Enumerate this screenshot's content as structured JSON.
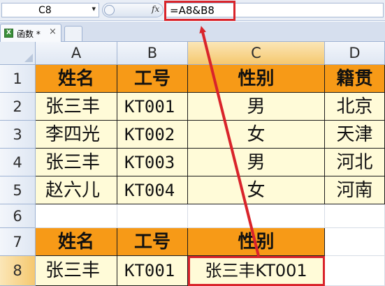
{
  "formula_bar": {
    "name_box": "C8",
    "name_box_arrow": "▾",
    "fx_label": "fx",
    "formula": "=A8&B8"
  },
  "tabs": {
    "active": {
      "icon": "excel-workbook-icon",
      "icon_glyph": "X",
      "label": "函数 *",
      "close_glyph": "×"
    }
  },
  "sheet": {
    "columns": [
      "A",
      "B",
      "C",
      "D"
    ],
    "selected_column": "C",
    "rows": [
      "1",
      "2",
      "3",
      "4",
      "5",
      "6",
      "7",
      "8"
    ],
    "selected_row": "8",
    "table1": {
      "headers": [
        "姓名",
        "工号",
        "性别",
        "籍贯"
      ],
      "rows": [
        [
          "张三丰",
          "KT001",
          "男",
          "北京"
        ],
        [
          "李四光",
          "KT002",
          "女",
          "天津"
        ],
        [
          "张三丰",
          "KT003",
          "男",
          "河北"
        ],
        [
          "赵六儿",
          "KT004",
          "女",
          "河南"
        ]
      ]
    },
    "table2": {
      "headers": [
        "姓名",
        "工号",
        "性别"
      ],
      "row": [
        "张三丰",
        "KT001",
        "张三丰KT001"
      ]
    }
  },
  "colors": {
    "header_fill": "#f79a17",
    "data_fill": "#fffbd8",
    "highlight": "#d9242b"
  }
}
